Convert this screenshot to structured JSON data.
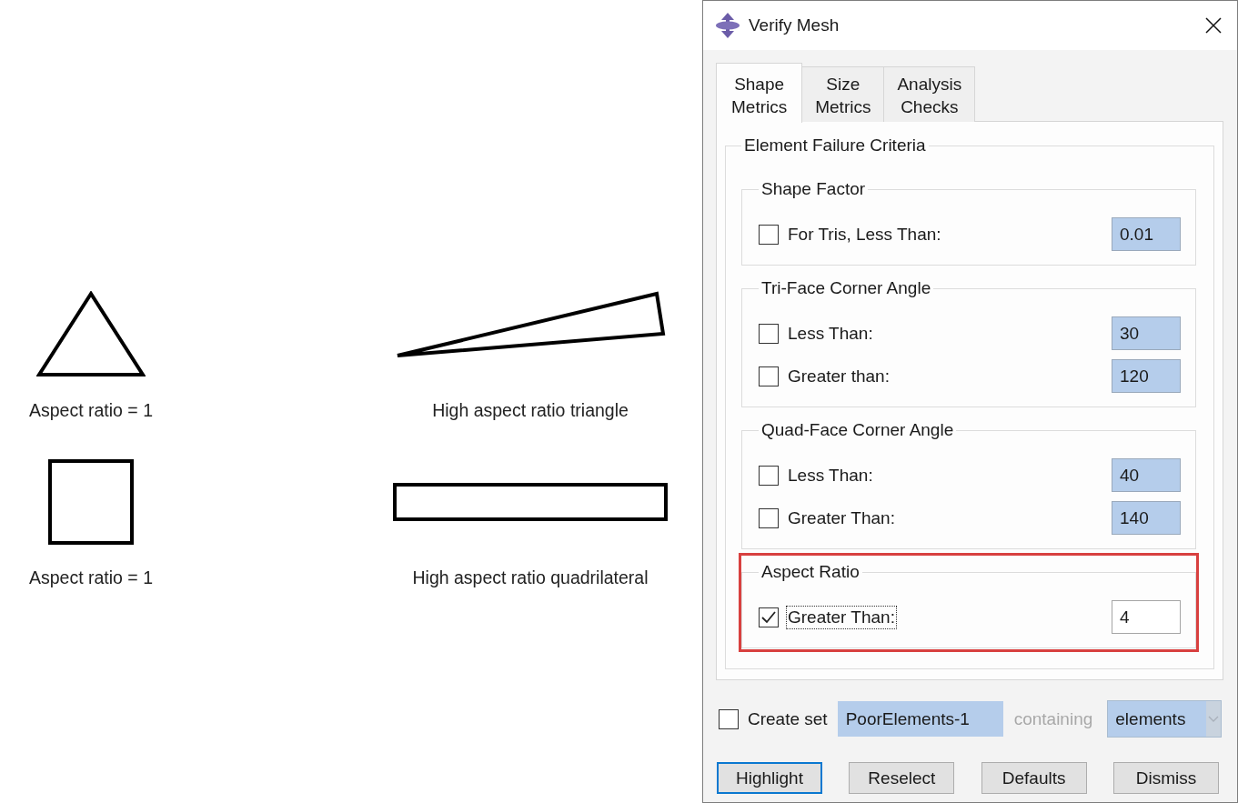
{
  "figure": {
    "items": [
      {
        "kind": "equilateral_triangle",
        "caption": "Aspect ratio = 1"
      },
      {
        "kind": "sliver_triangle",
        "caption": "High aspect ratio triangle"
      },
      {
        "kind": "square",
        "caption": "Aspect ratio = 1"
      },
      {
        "kind": "long_rectangle",
        "caption": "High aspect ratio quadrilateral"
      }
    ]
  },
  "dialog": {
    "title": "Verify Mesh",
    "tabs": [
      {
        "label": "Shape Metrics",
        "selected": true
      },
      {
        "label": "Size Metrics",
        "selected": false
      },
      {
        "label": "Analysis Checks",
        "selected": false
      }
    ],
    "criteria": {
      "title": "Element Failure Criteria",
      "groups": [
        {
          "title": "Shape Factor",
          "highlighted": false,
          "rows": [
            {
              "label": "For Tris, Less Than:",
              "checked": false,
              "focused": false,
              "value": "0.01",
              "inactive": true
            }
          ]
        },
        {
          "title": "Tri-Face Corner Angle",
          "highlighted": false,
          "rows": [
            {
              "label": "Less Than:",
              "checked": false,
              "focused": false,
              "value": "30",
              "inactive": true
            },
            {
              "label": "Greater than:",
              "checked": false,
              "focused": false,
              "value": "120",
              "inactive": true
            }
          ]
        },
        {
          "title": "Quad-Face Corner Angle",
          "highlighted": false,
          "rows": [
            {
              "label": "Less Than:",
              "checked": false,
              "focused": false,
              "value": "40",
              "inactive": true
            },
            {
              "label": "Greater Than:",
              "checked": false,
              "focused": false,
              "value": "140",
              "inactive": true
            }
          ]
        },
        {
          "title": "Aspect Ratio",
          "highlighted": true,
          "rows": [
            {
              "label": "Greater Than:",
              "checked": true,
              "focused": true,
              "value": "4",
              "inactive": false
            }
          ]
        }
      ]
    },
    "create_set": {
      "label": "Create set",
      "checked": false,
      "name": "PoorElements-1",
      "name_inactive": true,
      "containing_label": "containing",
      "containing_disabled": true,
      "type": "elements",
      "type_inactive": true
    },
    "buttons": [
      {
        "label": "Highlight",
        "focused": true
      },
      {
        "label": "Reselect",
        "focused": false
      },
      {
        "label": "Defaults",
        "focused": false
      },
      {
        "label": "Dismiss",
        "focused": false
      }
    ]
  }
}
